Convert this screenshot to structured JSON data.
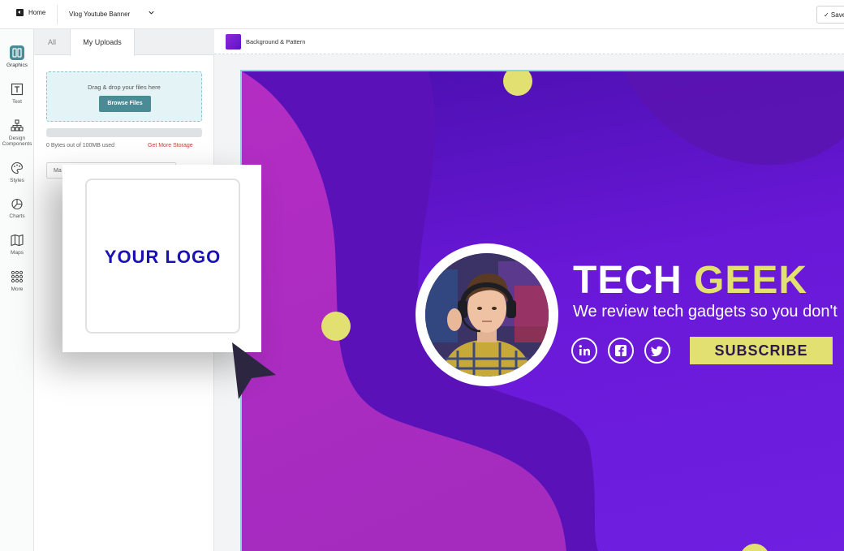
{
  "topbar": {
    "home_label": "Home",
    "document_title": "Vlog Youtube Banner",
    "save_label": "✓ Save"
  },
  "rail": {
    "items": [
      {
        "label": "Graphics",
        "icon": "graphics-icon",
        "active": true
      },
      {
        "label": "Text",
        "icon": "text-icon"
      },
      {
        "label": "Design Components",
        "icon": "design-components-icon"
      },
      {
        "label": "Styles",
        "icon": "palette-icon"
      },
      {
        "label": "Charts",
        "icon": "pie-chart-icon"
      },
      {
        "label": "Maps",
        "icon": "map-icon"
      },
      {
        "label": "More",
        "icon": "grid-dots-icon"
      }
    ]
  },
  "panel": {
    "tabs": [
      {
        "label": "All"
      },
      {
        "label": "My Uploads",
        "active": true
      }
    ],
    "dropzone_text": "Drag & drop your files here",
    "browse_label": "Browse Files",
    "storage_used_fraction": 0,
    "storage_text": "0 Bytes out of 100MB used",
    "storage_link": "Get More Storage",
    "field_text": "Ma"
  },
  "canvas_toolbar": {
    "background_label": "Background & Pattern",
    "swatch_color": "#7a1fd6"
  },
  "banner": {
    "title_word1": "TECH",
    "title_word2": "GEEK",
    "tagline": "We review tech gadgets so you don't",
    "subscribe_label": "SUBSCRIBE",
    "social_icons": [
      "linkedin-icon",
      "facebook-icon",
      "twitter-icon"
    ],
    "colors": {
      "accent": "#e3e072",
      "purple_dark": "#4a0fae",
      "magenta": "#b42dc3"
    }
  },
  "logo_card": {
    "logo_text": "YOUR LOGO"
  }
}
